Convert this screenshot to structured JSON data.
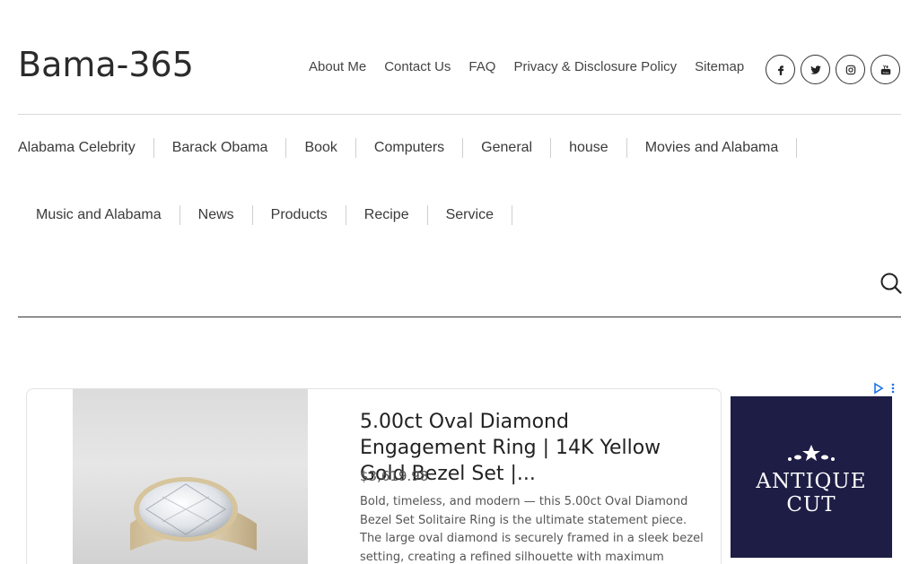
{
  "site": {
    "title": "Bama-365"
  },
  "top_nav": [
    "About Me",
    "Contact Us",
    "FAQ",
    "Privacy & Disclosure Policy",
    "Sitemap"
  ],
  "social": [
    {
      "name": "facebook-icon",
      "glyph": "f"
    },
    {
      "name": "twitter-icon",
      "glyph": "t"
    },
    {
      "name": "instagram-icon",
      "glyph": "i"
    },
    {
      "name": "youtube-icon",
      "glyph": "y"
    }
  ],
  "categories_row1": [
    "Alabama Celebrity",
    "Barack Obama",
    "Book",
    "Computers",
    "General",
    "house",
    "Movies and Alabama"
  ],
  "categories_row2": [
    "Music and Alabama",
    "News",
    "Products",
    "Recipe",
    "Service"
  ],
  "ad": {
    "title": "5.00ct Oval Diamond Engagement Ring | 14K Yellow Gold Bezel Set |...",
    "price": "$3,619.98",
    "description": "Bold, timeless, and modern — this 5.00ct Oval Diamond Bezel Set Solitaire Ring is the ultimate statement piece. The large oval diamond is securely framed in a sleek bezel setting, creating a refined silhouette with maximum brilliance. Stone Details:..."
  },
  "banner": {
    "text": "ANTIQUE CUT",
    "bg_color": "#1d1d45"
  },
  "colors": {
    "text": "#333333",
    "rule": "#333333",
    "adchoice": "#1a73e8"
  }
}
